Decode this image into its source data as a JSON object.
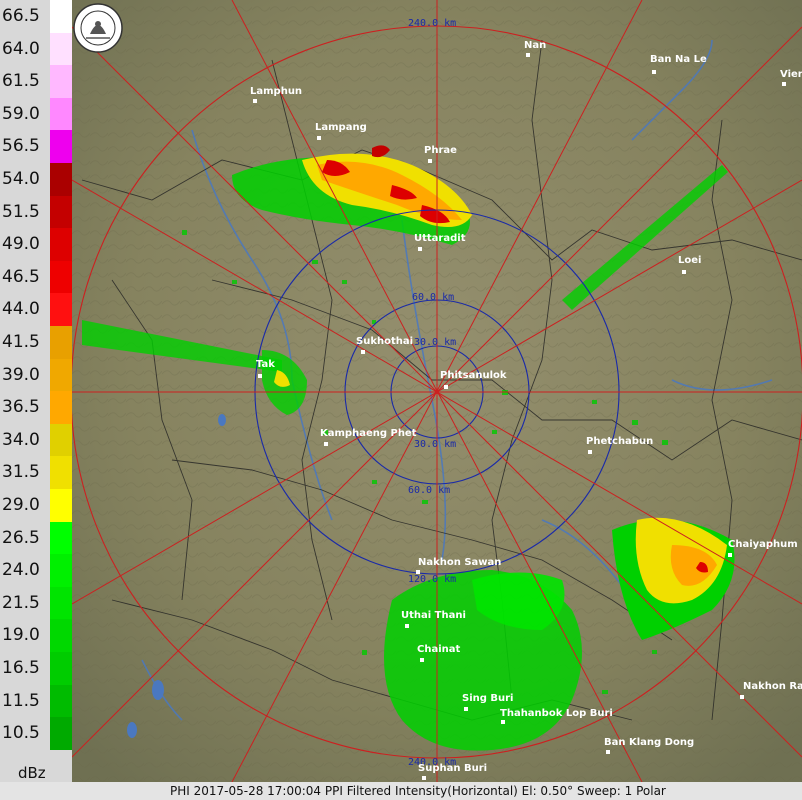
{
  "legend": {
    "unit": "dBz",
    "levels": [
      {
        "label": "66.5",
        "color": "#ffffff"
      },
      {
        "label": "64.0",
        "color": "#ffe0ff"
      },
      {
        "label": "61.5",
        "color": "#ffb8ff"
      },
      {
        "label": "59.0",
        "color": "#ff88ff"
      },
      {
        "label": "56.5",
        "color": "#ee00ee"
      },
      {
        "label": "54.0",
        "color": "#aa0000"
      },
      {
        "label": "51.5",
        "color": "#c40000"
      },
      {
        "label": "49.0",
        "color": "#dd0000"
      },
      {
        "label": "46.5",
        "color": "#ee0000"
      },
      {
        "label": "44.0",
        "color": "#ff1010"
      },
      {
        "label": "41.5",
        "color": "#e8a000"
      },
      {
        "label": "39.0",
        "color": "#f0a800"
      },
      {
        "label": "36.5",
        "color": "#ffa800"
      },
      {
        "label": "34.0",
        "color": "#e0d000"
      },
      {
        "label": "31.5",
        "color": "#f0e000"
      },
      {
        "label": "29.0",
        "color": "#ffff00"
      },
      {
        "label": "26.5",
        "color": "#00ff00"
      },
      {
        "label": "24.0",
        "color": "#00f000"
      },
      {
        "label": "21.5",
        "color": "#00e400"
      },
      {
        "label": "19.0",
        "color": "#00d800"
      },
      {
        "label": "16.5",
        "color": "#00cc00"
      },
      {
        "label": "11.5",
        "color": "#00bb00"
      },
      {
        "label": "10.5",
        "color": "#00aa00"
      }
    ]
  },
  "rings": {
    "r30": "30.0 km",
    "r60": "60.0 km",
    "r120": "120.0 km",
    "r240": "240.0 km"
  },
  "cities": [
    {
      "name": "Nan"
    },
    {
      "name": "Ban Na Le"
    },
    {
      "name": "Vien"
    },
    {
      "name": "Lamphun"
    },
    {
      "name": "Lampang"
    },
    {
      "name": "Phrae"
    },
    {
      "name": "Uttaradit"
    },
    {
      "name": "Loei"
    },
    {
      "name": "Sukhothai"
    },
    {
      "name": "Phitsanulok"
    },
    {
      "name": "Tak"
    },
    {
      "name": "Kamphaeng Phet"
    },
    {
      "name": "Phetchabun"
    },
    {
      "name": "Chaiyaphum"
    },
    {
      "name": "Nakhon Sawan"
    },
    {
      "name": "Uthai Thani"
    },
    {
      "name": "Chainat"
    },
    {
      "name": "Sing Buri"
    },
    {
      "name": "Thahanbok Lop Buri"
    },
    {
      "name": "Nakhon Ra"
    },
    {
      "name": "Ban Klang Dong"
    },
    {
      "name": "Suphan Buri"
    }
  ],
  "status": {
    "text": "PHI 2017-05-28 17:00:04 PPI Filtered Intensity(Horizontal)  El: 0.50°  Sweep: 1 Polar"
  }
}
